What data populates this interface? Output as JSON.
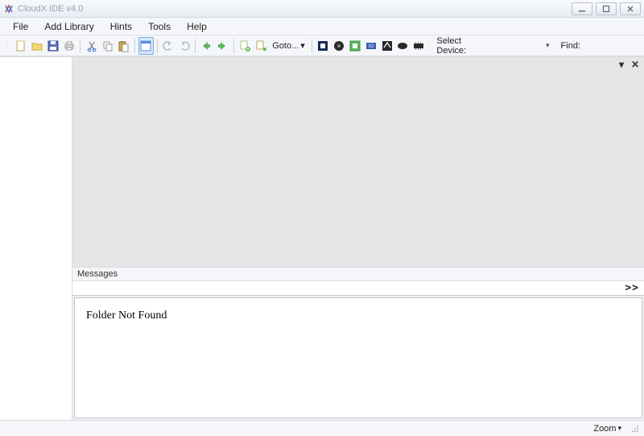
{
  "window": {
    "title": "CloudX IDE v4.0"
  },
  "menubar": {
    "items": [
      "File",
      "Add Library",
      "Hints",
      "Tools",
      "Help"
    ]
  },
  "toolbar": {
    "goto_label": "Goto...",
    "select_device_label": "Select Device:",
    "find_label": "Find:"
  },
  "panels": {
    "messages_header": "Messages",
    "messages_advance": ">>",
    "messages_body": "Folder Not Found"
  },
  "statusbar": {
    "zoom_label": "Zoom"
  }
}
